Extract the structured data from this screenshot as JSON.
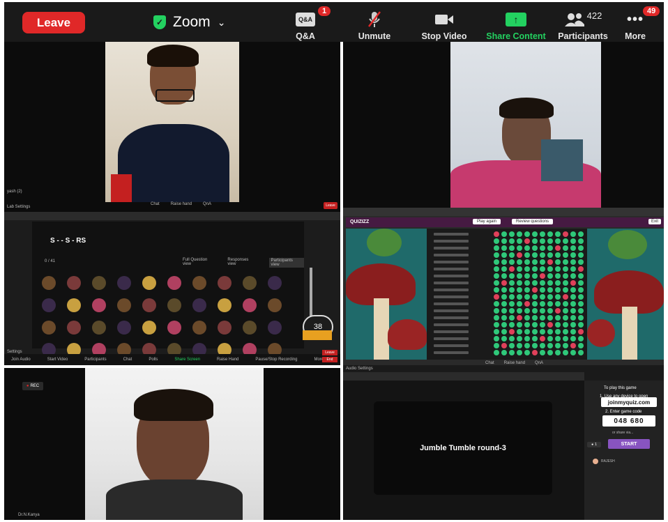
{
  "toolbar": {
    "leave_label": "Leave",
    "app_title": "Zoom",
    "qa_label": "Q&A",
    "qa_icon_text": "Q&A",
    "qa_badge": "1",
    "unmute_label": "Unmute",
    "stop_video_label": "Stop Video",
    "share_label": "Share Content",
    "participants_label": "Participants",
    "participants_count": "422",
    "more_label": "More",
    "more_badge": "49",
    "colors": {
      "leave": "#e02828",
      "share": "#23d160",
      "badge": "#e02828"
    }
  },
  "tiles": {
    "top_left": {
      "participant_name": "yash (2)",
      "footer_settings": "Lab Settings",
      "footer_buttons": [
        "Chat",
        "Raise hand",
        "QnA"
      ],
      "leave_small": "Leave"
    },
    "mid_left": {
      "question_title": "S - - S - RS",
      "counter": "0 / 41",
      "tabs": [
        "Full Question view",
        "Responses view",
        "Participants view"
      ],
      "timer": "38",
      "bottom_controls": [
        "Join Audio",
        "Start Video",
        "Participants",
        "Chat",
        "Polls",
        "Share Screen",
        "Raise Hand",
        "Pause/Stop Recording",
        "More"
      ],
      "end_small": "End",
      "leave_small": "Leave",
      "settings_small": "Settings"
    },
    "mid_right": {
      "logo": "QUIZIZZ",
      "play_again": "Play again",
      "review_questions": "Review questions",
      "exit": "Exit",
      "footer_buttons": [
        "Chat",
        "Raise hand",
        "QnA"
      ],
      "audio_settings": "Audio Settings"
    },
    "bottom_left": {
      "rec_label": "REC",
      "participant_name": "Dr.N.Kanya"
    },
    "bottom_right": {
      "game_title": "Jumble Tumble round-3",
      "instructions_title": "To play this game",
      "step1": "1. Use any device to open",
      "join_url": "joinmyquiz.com",
      "step2": "2. Enter game code",
      "game_code": "048 680",
      "share_via": "or share via...",
      "start_label": "START",
      "player_count": "1",
      "player_name": "RAJESH",
      "start_color": "#8854c0"
    }
  }
}
